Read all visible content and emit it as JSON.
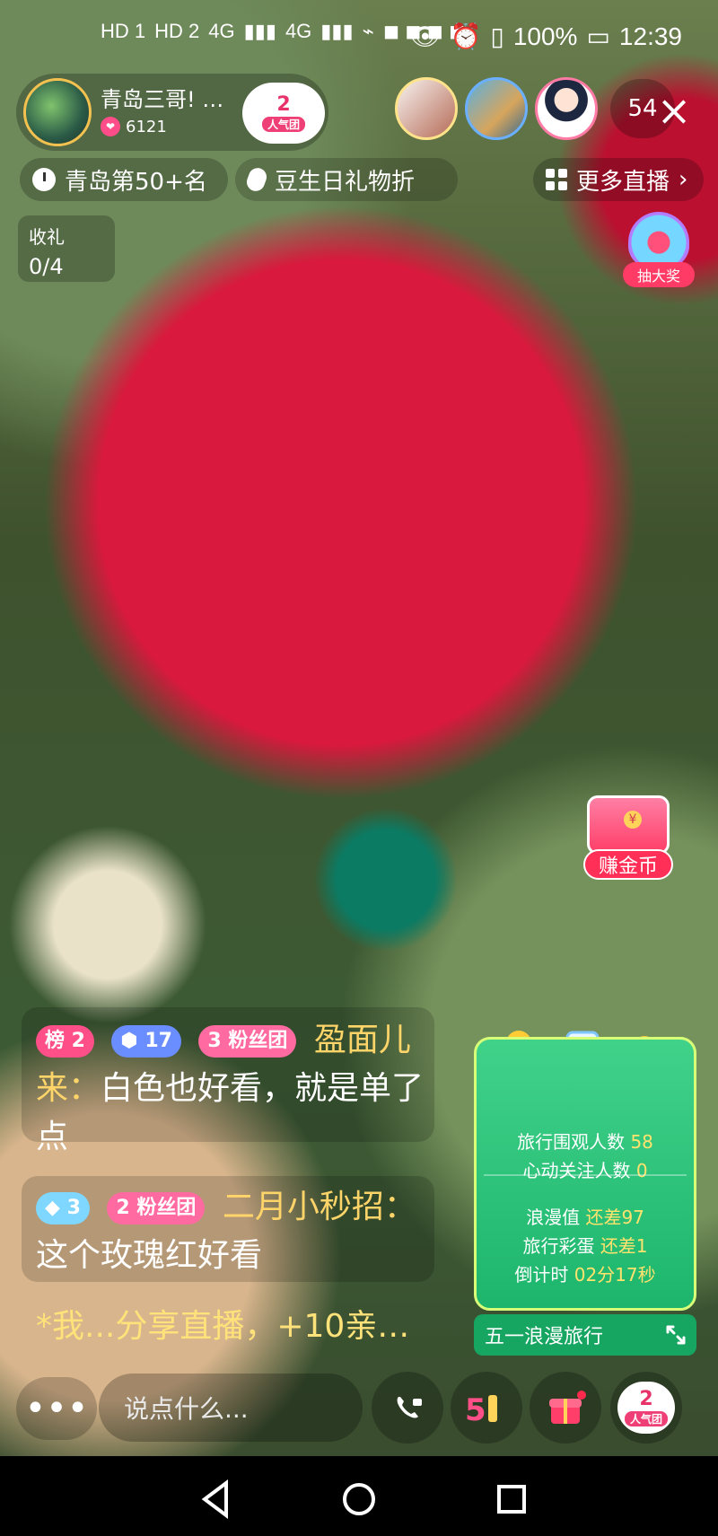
{
  "status_bar": {
    "sim1": "HD 1",
    "sim2": "HD 2",
    "net1": "4G",
    "net2": "4G",
    "battery_percent": "100%",
    "time": "12:39"
  },
  "live": {
    "host_name": "青岛三哥! …",
    "host_likes": "6121",
    "popularity_level": "2",
    "popularity_label": "人气团",
    "viewer_count": "54",
    "rank_chip": "青岛第50+名",
    "activity_chip": "豆生日礼物折",
    "more_live": "更多直播",
    "gift_receive_label": "收礼",
    "gift_receive_progress": "0/4",
    "lottery_label": "抽大奖",
    "coin_label": "赚金币"
  },
  "chat": {
    "msg1": {
      "rank_tag": "榜 2",
      "gem_tag": "17",
      "fan_tag_level": "3",
      "fan_tag_label": "粉丝团",
      "user": "盈面儿来：",
      "text": "白色也好看，就是单了点"
    },
    "msg2": {
      "gem_tag": "3",
      "fan_tag_level": "2",
      "fan_tag_label": "粉丝团",
      "user": "二月小秒招：",
      "text": "这个玫瑰红好看"
    },
    "system": "*我...分享直播，+10亲…"
  },
  "travel_panel": {
    "onlookers_label": "旅行围观人数",
    "onlookers_value": "58",
    "follow_label": "心动关注人数",
    "follow_value": "0",
    "romance_label": "浪漫值",
    "romance_value": "还差97",
    "egg_label": "旅行彩蛋",
    "egg_value": "还差1",
    "countdown_label": "倒计时",
    "countdown_value": "02分17秒",
    "title": "五一浪漫旅行"
  },
  "bottom": {
    "more_dots": "•••",
    "input_placeholder": "说点什么...",
    "popularity_level": "2",
    "popularity_label": "人气团"
  }
}
